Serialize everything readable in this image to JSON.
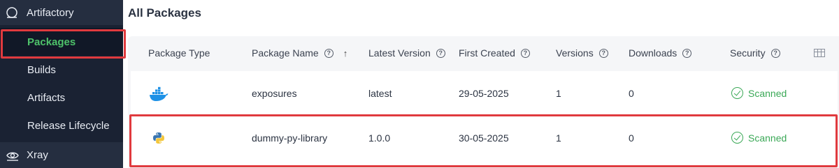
{
  "sidebar": {
    "artifactory": {
      "label": "Artifactory",
      "icon": "circle-icon"
    },
    "items": [
      {
        "label": "Packages",
        "active": true
      },
      {
        "label": "Builds"
      },
      {
        "label": "Artifacts"
      },
      {
        "label": "Release Lifecycle"
      }
    ],
    "xray": {
      "label": "Xray",
      "icon": "eye-icon"
    }
  },
  "main": {
    "title": "All Packages",
    "columns": [
      {
        "label": "Package Type"
      },
      {
        "label": "Package Name",
        "help": true,
        "sort": "ascending"
      },
      {
        "label": "Latest Version",
        "help": true
      },
      {
        "label": "First Created",
        "help": true
      },
      {
        "label": "Versions",
        "help": true
      },
      {
        "label": "Downloads",
        "help": true
      },
      {
        "label": "Security",
        "help": true
      }
    ],
    "rows": [
      {
        "type_icon": "docker-icon",
        "name": "exposures",
        "latest_version": "latest",
        "first_created": "29-05-2025",
        "versions": "1",
        "downloads": "0",
        "security": "Scanned"
      },
      {
        "type_icon": "python-icon",
        "name": "dummy-py-library",
        "latest_version": "1.0.0",
        "first_created": "30-05-2025",
        "versions": "1",
        "downloads": "0",
        "security": "Scanned"
      }
    ]
  },
  "colors": {
    "sidebar_bg": "#1a2233",
    "active_text": "#4ec26a",
    "highlight": "#e03a3e",
    "scanned": "#3aa856"
  }
}
